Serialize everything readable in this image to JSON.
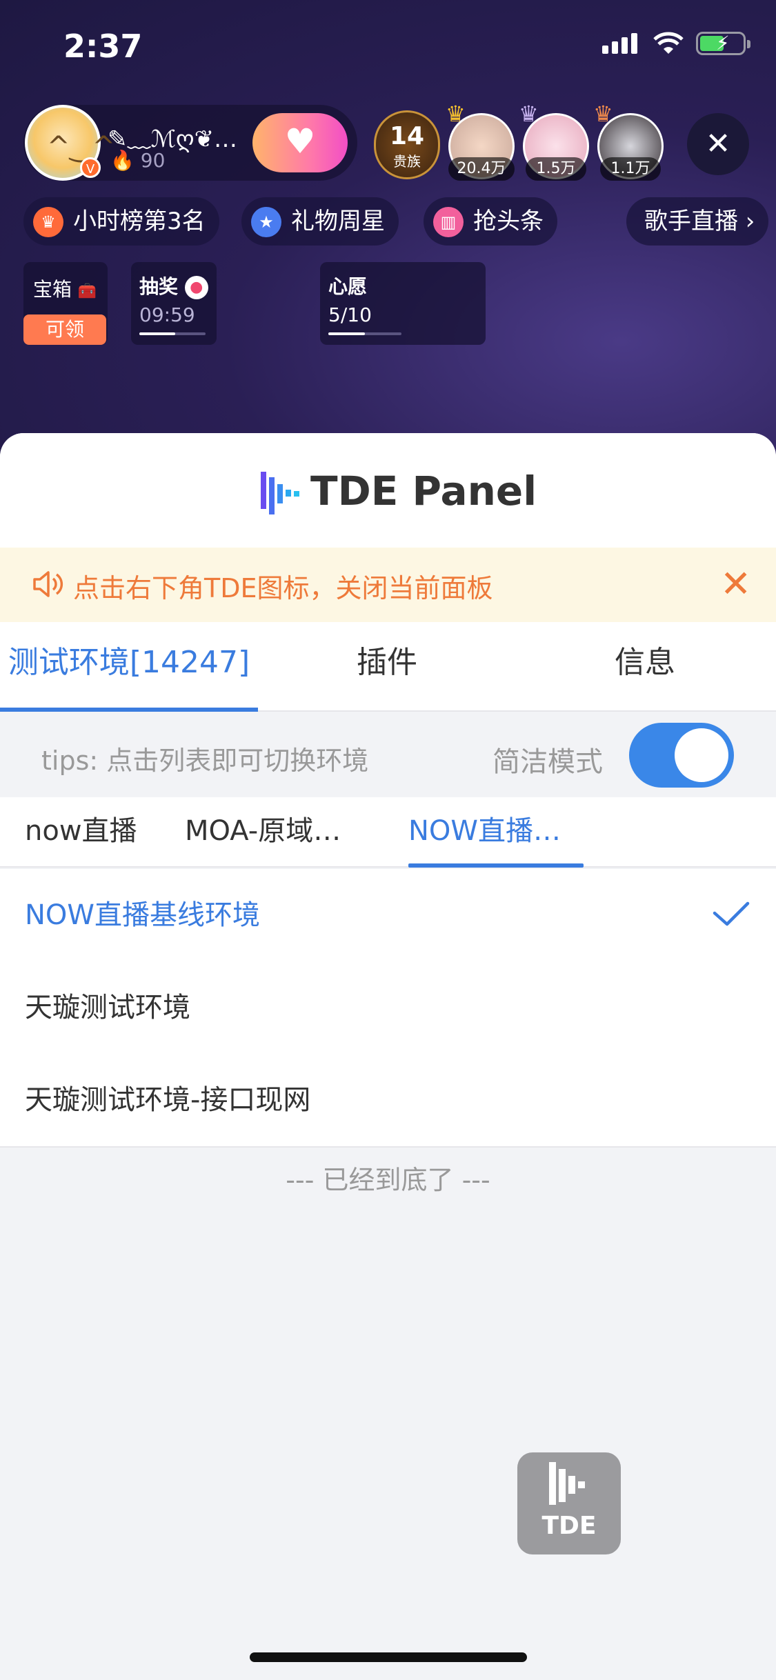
{
  "status_bar": {
    "time": "2:37"
  },
  "host": {
    "name": "✎﹏ℳღ❦…",
    "heat": "90"
  },
  "viewers": {
    "noble_count": "14",
    "noble_label": "贵族",
    "counts": [
      "20.4万",
      "1.5万",
      "1.1万"
    ]
  },
  "chips": {
    "hour_rank": "小时榜第3名",
    "gift_star": "礼物周星",
    "headline": "抢头条",
    "singer": "歌手直播 ›"
  },
  "widgets": {
    "treasure_title": "宝箱",
    "treasure_button": "可领",
    "lottery_title": "抽奖",
    "lottery_time": "09:59",
    "wish_title": "心愿",
    "wish_progress": "5/10",
    "wish_fraction": 0.5
  },
  "panel": {
    "title": "TDE Panel",
    "notice": "点击右下角TDE图标，关闭当前面板",
    "tabs": [
      "测试环境[14247]",
      "插件",
      "信息"
    ],
    "tips": "tips: 点击列表即可切换环境",
    "simple_mode_label": "简洁模式",
    "simple_mode_on": true,
    "subtabs": [
      "now直播",
      "MOA-原域…",
      "NOW直播…"
    ],
    "environments": [
      "NOW直播基线环境",
      "天璇测试环境",
      "天璇测试环境-接口现网"
    ],
    "selected_index": 0,
    "end_note": "--- 已经到底了 ---",
    "float_button": "TDE"
  },
  "colors": {
    "accent": "#3a7cdf",
    "notice": "#ee7a3a",
    "notice_bg": "#fdf7e3"
  }
}
